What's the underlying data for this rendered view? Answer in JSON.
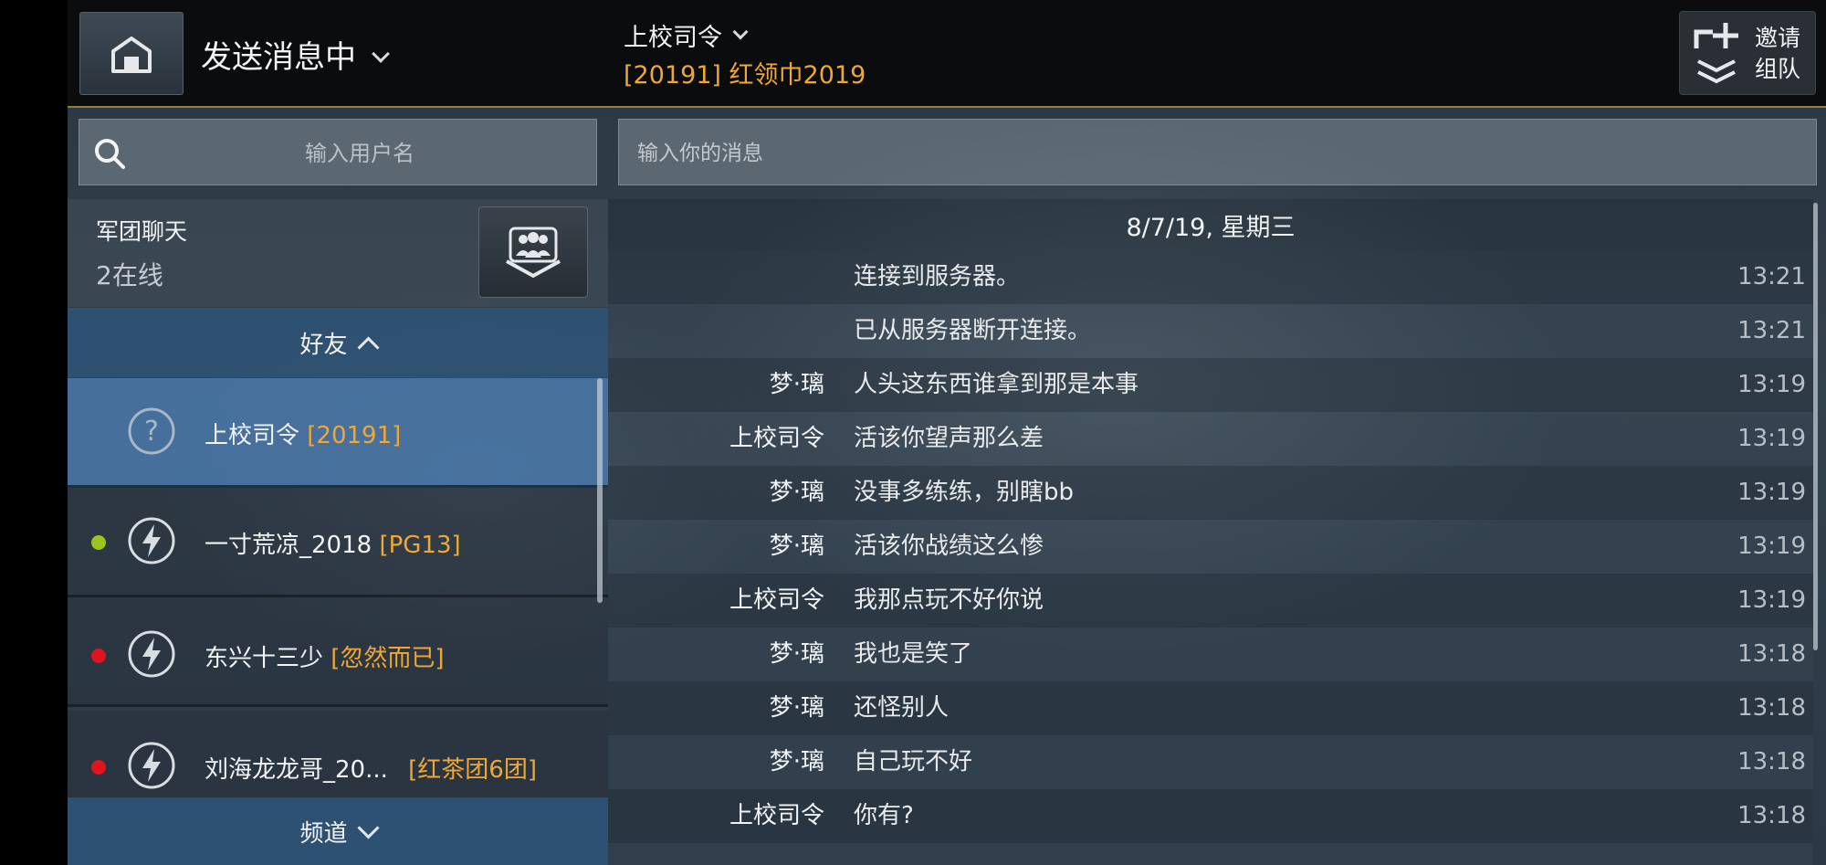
{
  "header": {
    "status_label": "发送消息中",
    "chat_title": "上校司令",
    "chat_subtitle": "[20191] 红领巾2019",
    "invite_label_line1": "邀请",
    "invite_label_line2": "组队"
  },
  "left_panel": {
    "search_placeholder": "输入用户名",
    "legion_chat_title": "军团聊天",
    "legion_online": "2在线",
    "friends_label": "好友",
    "channels_label": "频道",
    "friends": [
      {
        "name": "上校司令",
        "tag": "[20191]",
        "status": "unknown",
        "icon": "question-icon"
      },
      {
        "name": "一寸荒凉_2018",
        "tag": "[PG13]",
        "status": "online",
        "status_color": "#9ac41e",
        "icon": "lightning-icon"
      },
      {
        "name": "东兴十三少",
        "tag": "[忽然而已]",
        "status": "offline",
        "status_color": "#e0141e",
        "icon": "lightning-icon"
      },
      {
        "name": "刘海龙龙哥_20...",
        "tag": "[红茶团6团]",
        "status": "offline",
        "status_color": "#e0141e",
        "icon": "lightning-icon"
      }
    ]
  },
  "chat": {
    "input_placeholder": "输入你的消息",
    "date_label": "8/7/19, 星期三",
    "messages": [
      {
        "sender": "",
        "text": "连接到服务器。",
        "time": "13:21"
      },
      {
        "sender": "",
        "text": "已从服务器断开连接。",
        "time": "13:21"
      },
      {
        "sender": "梦·璃",
        "text": "人头这东西谁拿到那是本事",
        "time": "13:19"
      },
      {
        "sender": "上校司令",
        "text": "活该你望声那么差",
        "time": "13:19"
      },
      {
        "sender": "梦·璃",
        "text": "没事多练练，别瞎bb",
        "time": "13:19"
      },
      {
        "sender": "梦·璃",
        "text": "活该你战绩这么惨",
        "time": "13:19"
      },
      {
        "sender": "上校司令",
        "text": "我那点玩不好你说",
        "time": "13:19"
      },
      {
        "sender": "梦·璃",
        "text": "我也是笑了",
        "time": "13:18"
      },
      {
        "sender": "梦·璃",
        "text": "还怪别人",
        "time": "13:18"
      },
      {
        "sender": "梦·璃",
        "text": "自己玩不好",
        "time": "13:18"
      },
      {
        "sender": "上校司令",
        "text": "你有?",
        "time": "13:18"
      }
    ]
  },
  "colors": {
    "accent": "#f0a832",
    "selected_row": "#4a78aa",
    "header_band": "#2e5478"
  }
}
